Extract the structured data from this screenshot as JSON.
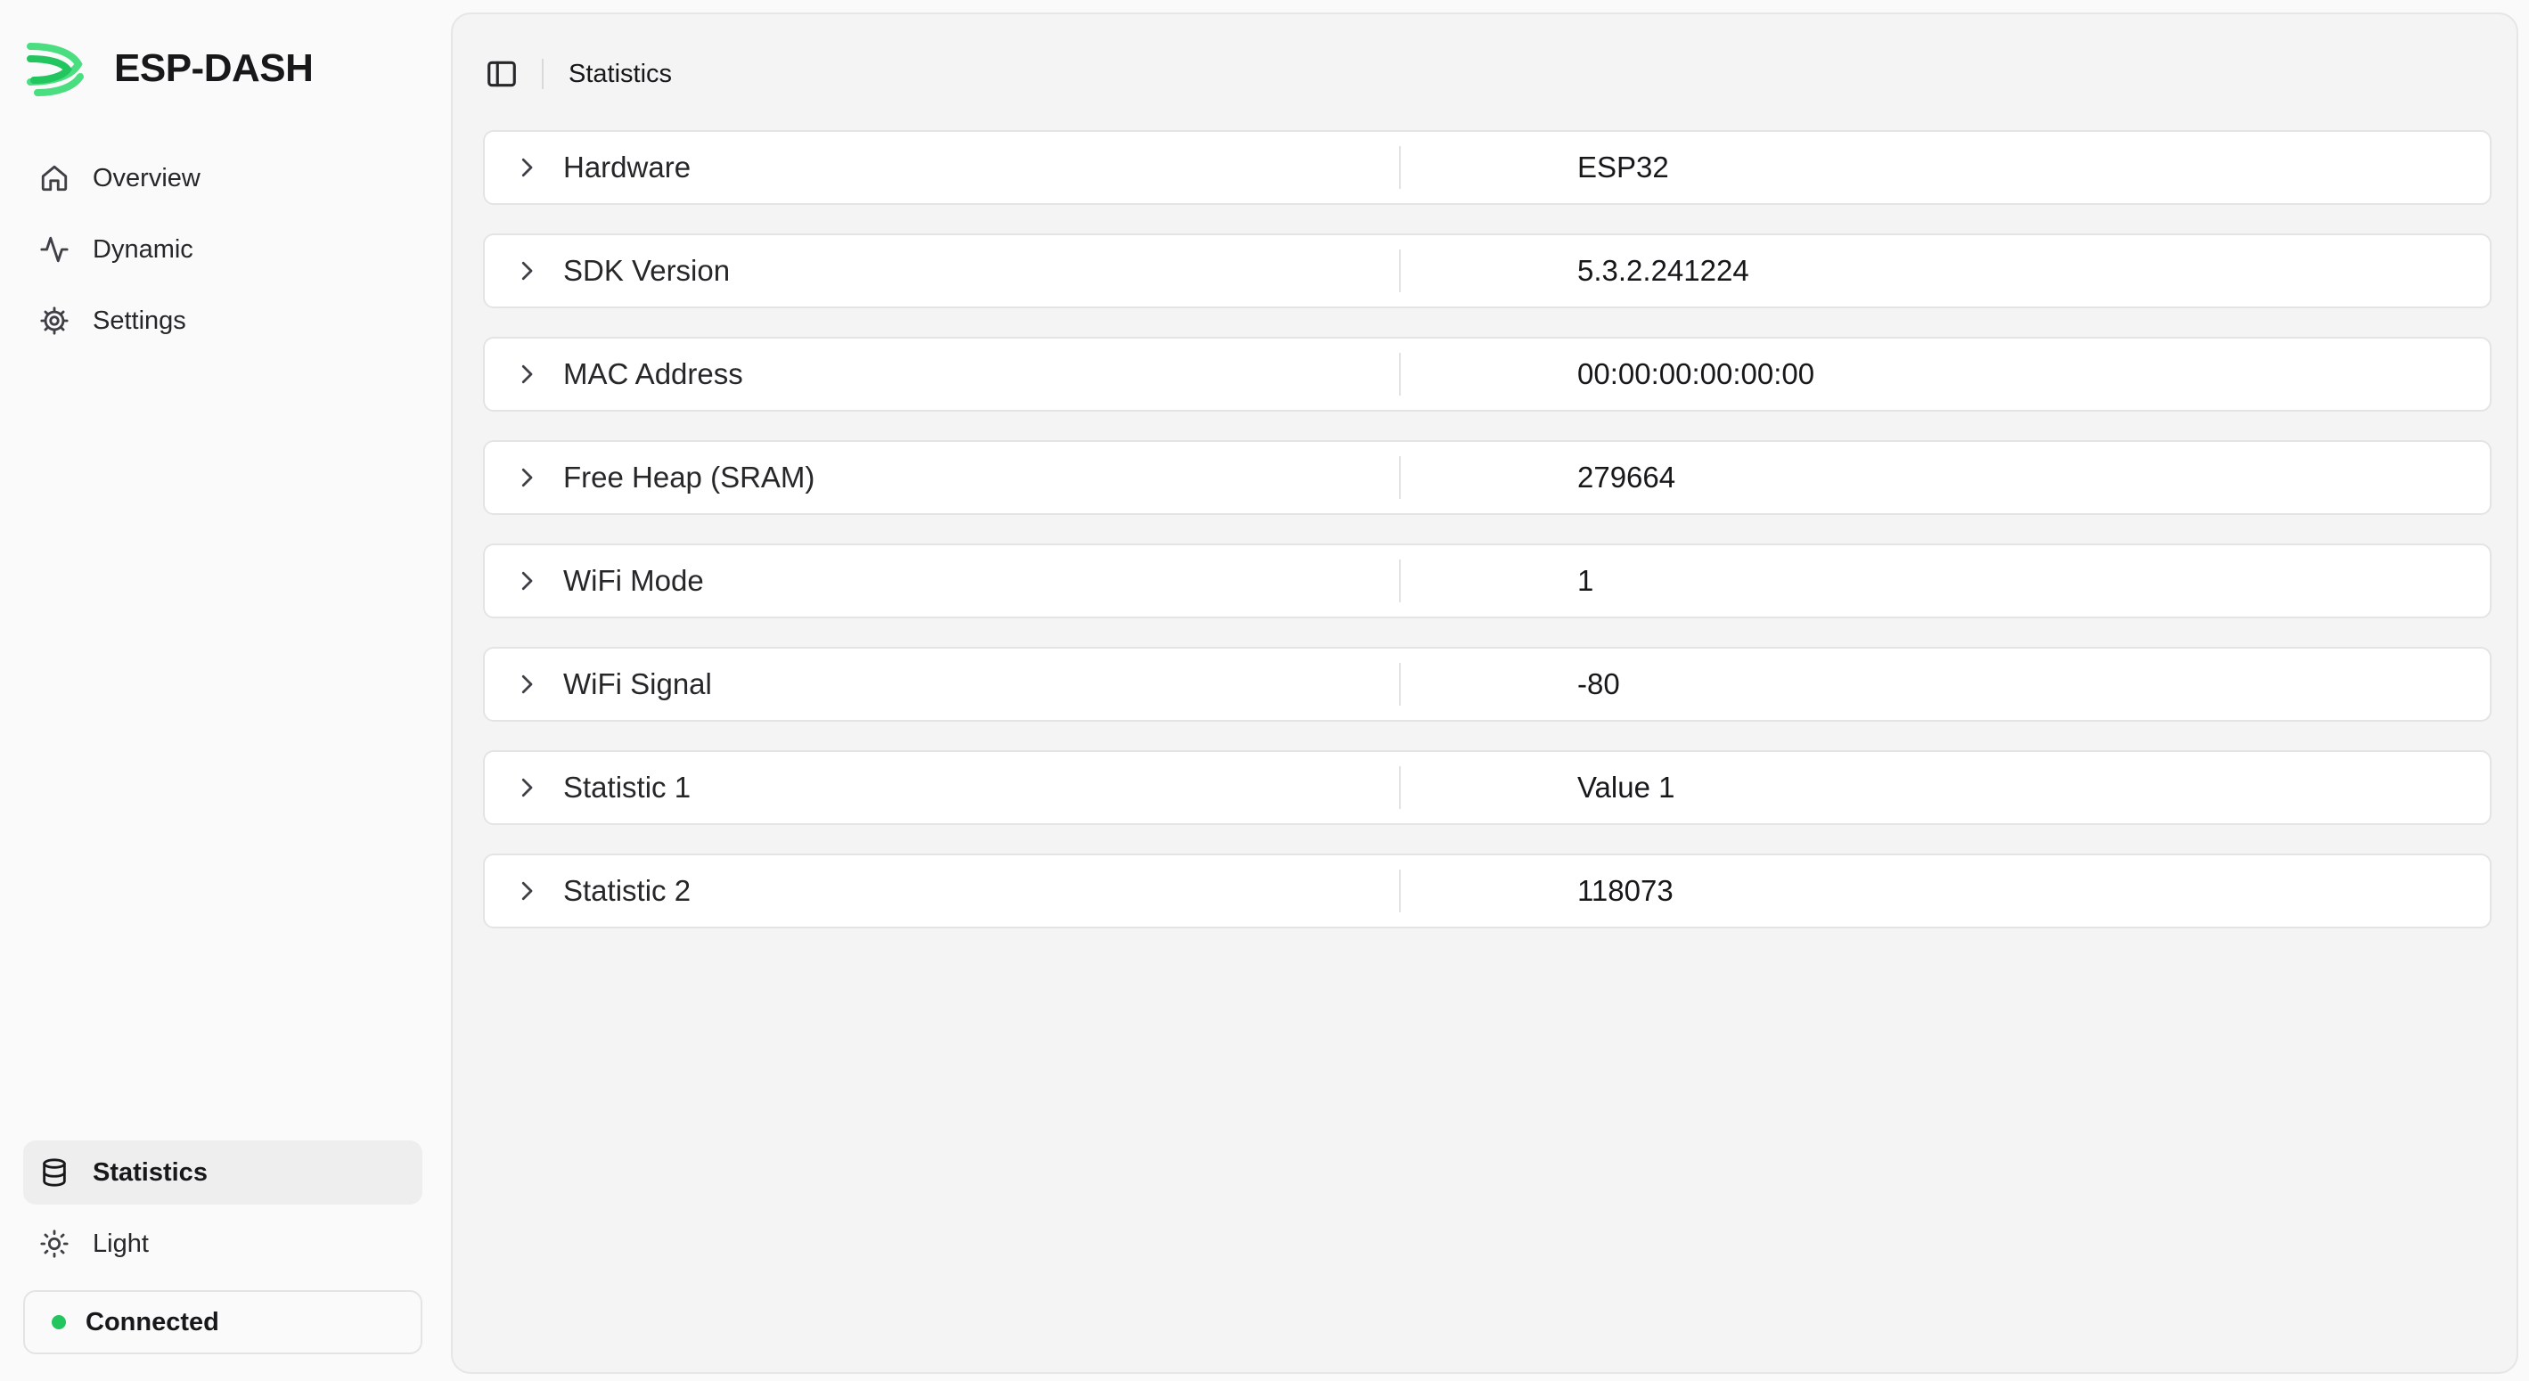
{
  "app": {
    "name": "ESP-DASH"
  },
  "sidebar": {
    "items": [
      {
        "label": "Overview",
        "icon": "home-icon"
      },
      {
        "label": "Dynamic",
        "icon": "activity-icon"
      },
      {
        "label": "Settings",
        "icon": "gear-icon"
      }
    ],
    "bottom": {
      "statistics_label": "Statistics",
      "theme_label": "Light",
      "status_label": "Connected",
      "status_color": "#22c55e"
    }
  },
  "header": {
    "title": "Statistics"
  },
  "statistics": [
    {
      "label": "Hardware",
      "value": "ESP32"
    },
    {
      "label": "SDK Version",
      "value": "5.3.2.241224"
    },
    {
      "label": "MAC Address",
      "value": "00:00:00:00:00:00"
    },
    {
      "label": "Free Heap (SRAM)",
      "value": "279664"
    },
    {
      "label": "WiFi Mode",
      "value": "1"
    },
    {
      "label": "WiFi Signal",
      "value": "-80"
    },
    {
      "label": "Statistic 1",
      "value": "Value 1"
    },
    {
      "label": "Statistic 2",
      "value": "118073"
    }
  ],
  "colors": {
    "brand": "#4ade80",
    "accent_status": "#22c55e"
  }
}
